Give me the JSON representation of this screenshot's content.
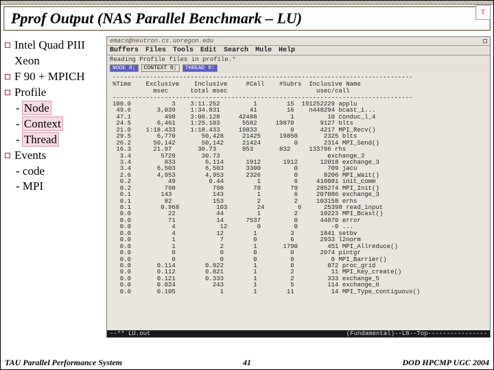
{
  "slide": {
    "title": "Pprof Output (NAS Parallel Benchmark – LU)",
    "footer_left": "TAU Parallel Performance System",
    "footer_center": "41",
    "footer_right": "DOD HPCMP UGC 2004"
  },
  "bullets": {
    "b0": "Intel Quad PIII Xeon",
    "b1": "F 90 + MPICH",
    "b2": "Profile",
    "b2a": "Node",
    "b2b": "Context",
    "b2c": "Thread",
    "b3": "Events",
    "b3a": "code",
    "b3b": "MPI"
  },
  "window": {
    "title": "emacs@neutron.cs.uoregon.edu",
    "menu": [
      "Buffers",
      "Files",
      "Tools",
      "Edit",
      "Search",
      "Mule",
      "Help"
    ],
    "reading": "Reading Profile files in profile.*",
    "tag1": "NODE 0;",
    "tag2": "CONTEXT 0;",
    "tag3": "THREAD 0:",
    "columns": "%Time    Exclusive    Inclusive     #Call    #Subrs  Inclusive Name\n           msec      total msec                        usec/call",
    "dashes": "---------------------------------------------------------------------------------",
    "rows": [
      "100.0           3    3:11.252         1        15  191252229 applu",
      " 49.6       3,039    1:34.831        41        16    n448294 bcast_i...",
      " 47.1         498    3:08.128     42488         1         10 conduc_l_4",
      " 24.5       6,461    1:25.103      5582     19870       9127 blts",
      " 21.0    1:18.433    1:18.433     19833         0       4217 MPI_Recv()",
      " 29.5       6,770       50,428     21425     19850       2325 blts",
      " 26.2      50,142       50,142     21424         0       2314 MPI_Send()",
      " 16.3      21.97       30.73       853       832     133786 rhs",
      "  3.4        5729       30.73                             exchange_3",
      "  3.4         833        6,114      1912      1912      12018 exchange_3",
      "  3.4       6,503        6,503      3300         0        709 jacu",
      "  2.6       4,953        4,953      2326         0       8206 MPI_Wait()",
      "  0.2          49         0.44         1         6     410081 init_comm",
      "  0.2         798          798        78        79     285274 MPI_Init()",
      "  0.1        143           143         1         6     207086 exchange_3",
      "  0.1         82           153         2         2     103158 erhs",
      "  0.1        0.968          103        24         6      25398 read_input",
      "  0.0          22           44         1         2      10223 MPI_Bcast()",
      "  0.0          71           14      7537         0      44070 error",
      "  0.0           4            12        0         0         -0 ...",
      "  0.0           4           12        1         3       1841 setbv",
      "  0.0           1            7        0         6       2933 l2norm",
      "  0.0           1            2        1       1790        451 MPI_Allreduce()",
      "  0.0           0            0        0         0       2074 pintgr",
      "  0.0           0            0        0         0          0 MPI_Barrier()",
      "  0.0       0.114        0.822        1         0         872 proc_grid",
      "  0.0       0.112        0.821        1         2          11 MPI_Key_create()",
      "  0.0       0.121        0.333        1         2         333 exchange_5",
      "  0.0       0.024          243        1         5         114 exchange_6",
      "  0.0       0.105            1        1        11          14 MPI_Type_contiguous()"
    ],
    "status_left": "--**  LU.out",
    "status_right": "(Fundamental)--L8--Top----------------"
  }
}
